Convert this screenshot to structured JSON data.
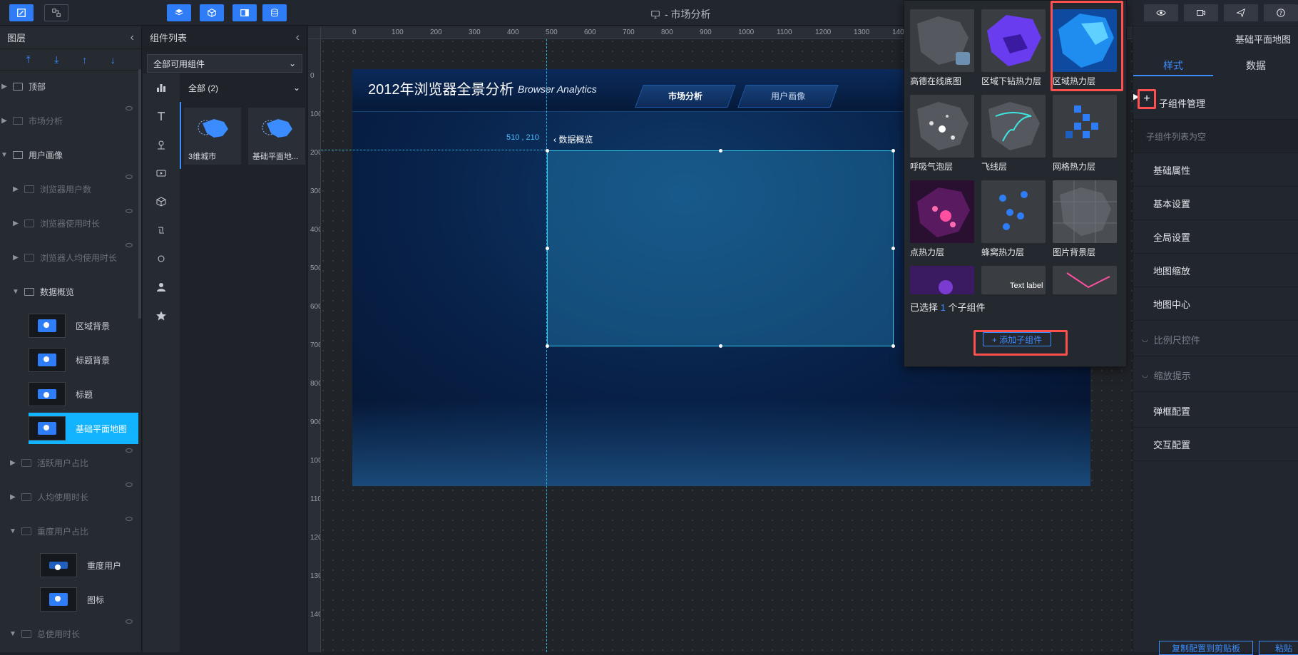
{
  "document": {
    "title": "- 市场分析"
  },
  "layer_panel": {
    "title": "图层",
    "items": [
      {
        "label": "顶部"
      },
      {
        "label": "市场分析"
      },
      {
        "label": "用户画像"
      },
      {
        "label": "浏览器用户数"
      },
      {
        "label": "浏览器使用时长"
      },
      {
        "label": "浏览器人均使用时长"
      },
      {
        "label": "数据概览"
      },
      {
        "label": "区域背景"
      },
      {
        "label": "标题背景"
      },
      {
        "label": "标题"
      },
      {
        "label": "基础平面地图"
      },
      {
        "label": "活跃用户占比"
      },
      {
        "label": "人均使用时长"
      },
      {
        "label": "重度用户占比"
      },
      {
        "label": "重度用户"
      },
      {
        "label": "图标"
      },
      {
        "label": "总使用时长"
      }
    ]
  },
  "component_panel": {
    "title": "组件列表",
    "filter_value": "全部可用组件",
    "category": "全部 (2)",
    "cards": [
      {
        "label": "3维城市"
      },
      {
        "label": "基础平面地..."
      }
    ]
  },
  "canvas": {
    "ruler_h": [
      "0",
      "100",
      "200",
      "300",
      "400",
      "500",
      "600",
      "700",
      "800",
      "900",
      "1000",
      "1100",
      "1200",
      "1300",
      "140"
    ],
    "ruler_v": [
      "0",
      "100",
      "200",
      "300",
      "400",
      "500",
      "600",
      "700",
      "800",
      "900",
      "1000",
      "1100",
      "1200",
      "1300",
      "1400"
    ],
    "coord_readout": "510 , 210",
    "board": {
      "title": "2012年浏览器全景分析",
      "subtitle": "Browser Analytics",
      "tabs": [
        "市场分析",
        "用户画像"
      ],
      "section_label": "数据概览"
    }
  },
  "popup": {
    "layers": [
      {
        "label": "高德在线底图"
      },
      {
        "label": "区域下钻热力层"
      },
      {
        "label": "区域热力层"
      },
      {
        "label": "呼吸气泡层"
      },
      {
        "label": "飞线层"
      },
      {
        "label": "网格热力层"
      },
      {
        "label": "点热力层"
      },
      {
        "label": "蜂窝热力层"
      },
      {
        "label": "图片背景层"
      },
      {
        "label": ""
      },
      {
        "label": "Text label"
      },
      {
        "label": ""
      }
    ],
    "selected_prefix": "已选择",
    "selected_count": "1",
    "selected_suffix": "个子组件",
    "add_button": "+ 添加子组件"
  },
  "right_panel": {
    "title": "基础平面地图",
    "tabs": {
      "style": "样式",
      "data": "数据"
    },
    "sub_manage": "子组件管理",
    "sub_empty": "子组件列表为空",
    "rows": [
      "基础属性",
      "基本设置",
      "全局设置",
      "地图缩放",
      "地图中心",
      "比例尺控件",
      "缩放提示",
      "弹框配置",
      "交互配置"
    ],
    "bottom_btn1": "复制配置到剪贴板",
    "bottom_btn2": "粘贴"
  }
}
